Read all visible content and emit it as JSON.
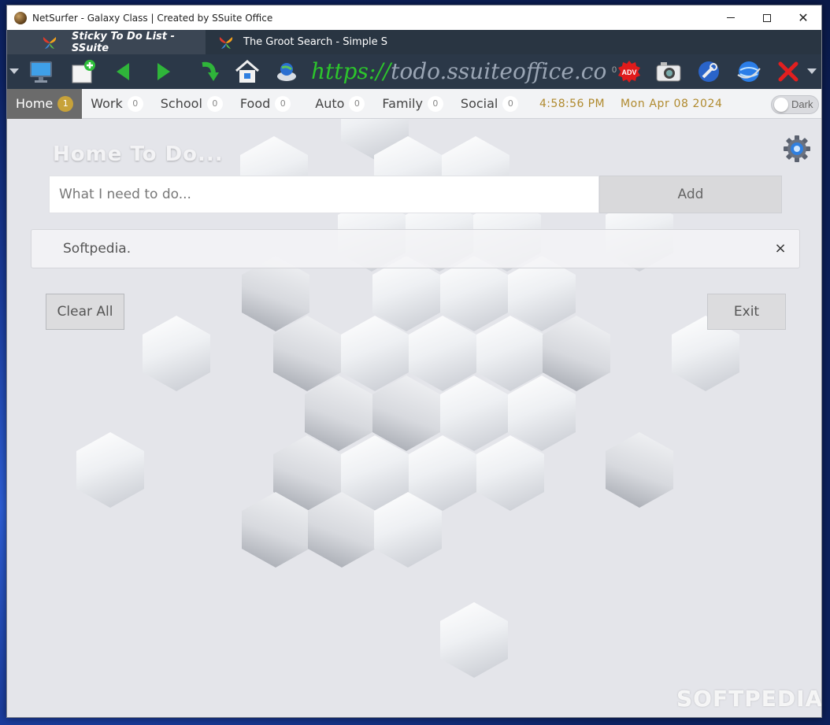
{
  "window": {
    "title": "NetSurfer - Galaxy Class | Created by SSuite Office"
  },
  "tabs": [
    {
      "label": "Sticky To Do List - SSuite",
      "active": true
    },
    {
      "label": "The Groot Search - Simple S",
      "active": false
    }
  ],
  "toolbar": {
    "url_scheme": "https://",
    "url_rest": "todo.ssuiteoffice.com",
    "counter": "0",
    "icons": [
      "dropdown-icon",
      "monitor-icon",
      "new-tab-icon",
      "back-icon",
      "forward-icon",
      "reload-icon",
      "home-icon",
      "globe-search-icon",
      "adv-icon",
      "camera-icon",
      "tools-icon",
      "web-globe-icon",
      "close-x-icon",
      "menu-dropdown-icon"
    ]
  },
  "nav": {
    "items": [
      {
        "label": "Home",
        "count": "1",
        "active": true
      },
      {
        "label": "Work",
        "count": "0"
      },
      {
        "label": "School",
        "count": "0"
      },
      {
        "label": "Food",
        "count": "0"
      },
      {
        "label": "Auto",
        "count": "0"
      },
      {
        "label": "Family",
        "count": "0"
      },
      {
        "label": "Social",
        "count": "0"
      }
    ],
    "time": "4:58:56 PM",
    "date": "Mon Apr 08 2024",
    "dark_toggle_label": "Dark",
    "dark_mode": false
  },
  "main": {
    "heading": "Home To Do...",
    "input_placeholder": "What I need to do...",
    "add_label": "Add",
    "todos": [
      {
        "text": "Softpedia.",
        "close": "×"
      }
    ],
    "clear_label": "Clear All",
    "exit_label": "Exit"
  },
  "watermark": "SOFTPEDIA",
  "colors": {
    "accent_gold": "#b08a2e",
    "url_scheme": "#2cc52c",
    "tabbar": "#293542",
    "toolbar": "#2b3848"
  }
}
